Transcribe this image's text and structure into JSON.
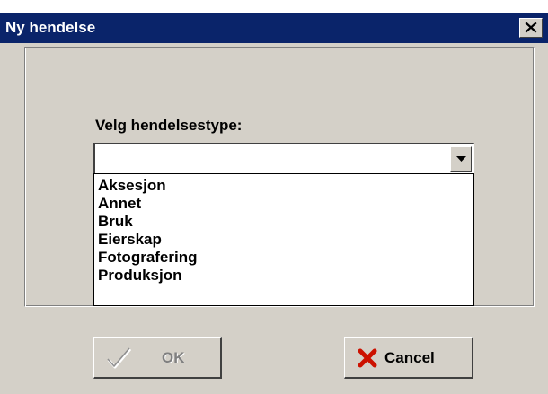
{
  "window": {
    "title": "Ny hendelse",
    "close_icon": "close-x-icon"
  },
  "form": {
    "prompt": "Velg hendelsestype:",
    "combo": {
      "value": "",
      "expanded": true,
      "arrow_icon": "dropdown-arrow-icon"
    },
    "options": [
      "Aksesjon",
      "Annet",
      "Bruk",
      "Eierskap",
      "Fotografering",
      "Produksjon"
    ]
  },
  "buttons": {
    "ok": {
      "label": "OK",
      "enabled": false,
      "icon": "checkmark-icon"
    },
    "cancel": {
      "label": "Cancel",
      "enabled": true,
      "icon": "red-x-icon"
    }
  },
  "colors": {
    "titlebar": "#0a246a",
    "dialog_face": "#d4d0c8",
    "cancel_icon_red": "#cc1100",
    "disabled_text": "#808080"
  }
}
